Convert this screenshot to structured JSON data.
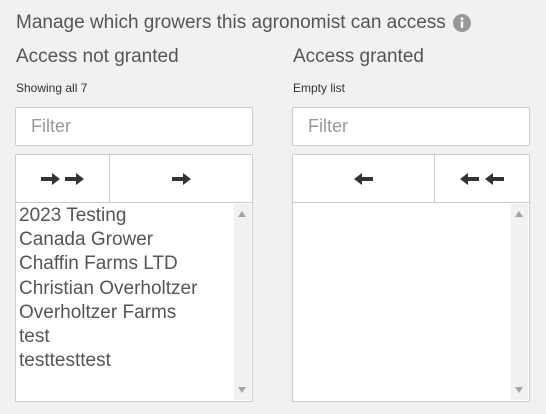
{
  "header": {
    "title": "Manage which growers this agronomist can access",
    "info_icon": "info-circle-icon"
  },
  "available": {
    "title": "Access not granted",
    "info": "Showing all 7",
    "filter_placeholder": "Filter",
    "buttons": [
      {
        "icon": "double-arrow-right-icon",
        "action": "move all"
      },
      {
        "icon": "arrow-right-icon",
        "action": "move selected"
      }
    ],
    "items": [
      "2023 Testing",
      "Canada Grower",
      "Chaffin Farms LTD",
      "Christian Overholtzer",
      "Overholtzer Farms",
      "test",
      "testtesttest"
    ]
  },
  "granted": {
    "title": "Access granted",
    "info": "Empty list",
    "filter_placeholder": "Filter",
    "buttons": [
      {
        "icon": "arrow-left-icon",
        "action": "remove selected"
      },
      {
        "icon": "double-arrow-left-icon",
        "action": "remove all"
      }
    ],
    "items": []
  },
  "colors": {
    "background": "#f1f1f1",
    "text": "#555555",
    "border": "#cccccc",
    "placeholder": "#999999"
  }
}
